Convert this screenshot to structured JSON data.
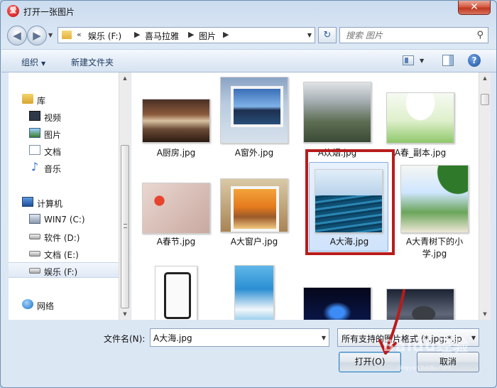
{
  "window": {
    "title": "打开一张图片",
    "close_label": "✕",
    "app_icon": "爱"
  },
  "nav_buttons": {
    "back": "◀",
    "forward": "▶"
  },
  "address": {
    "overflow": "«",
    "segments": [
      "娱乐 (F:)",
      "喜马拉雅",
      "图片"
    ]
  },
  "search": {
    "placeholder": "搜索 图片"
  },
  "toolbar": {
    "organize": "组织",
    "new_folder": "新建文件夹",
    "help": "?"
  },
  "sidebar": {
    "items": [
      {
        "label": "库",
        "icon": "library-icon"
      },
      {
        "label": "视频",
        "icon": "video-icon"
      },
      {
        "label": "图片",
        "icon": "pictures-icon"
      },
      {
        "label": "文档",
        "icon": "documents-icon"
      },
      {
        "label": "音乐",
        "icon": "music-icon"
      },
      {
        "label": "计算机",
        "icon": "computer-icon"
      },
      {
        "label": "WIN7 (C:)",
        "icon": "system-drive-icon"
      },
      {
        "label": "软件 (D:)",
        "icon": "drive-icon"
      },
      {
        "label": "文档 (E:)",
        "icon": "drive-icon"
      },
      {
        "label": "娱乐 (F:)",
        "icon": "drive-icon",
        "selected": true
      },
      {
        "label": "网络",
        "icon": "network-icon"
      }
    ]
  },
  "files": [
    {
      "name": "A厨房.jpg"
    },
    {
      "name": "A窗外.jpg"
    },
    {
      "name": "A炊烟.jpg"
    },
    {
      "name": "A春_副本.jpg"
    },
    {
      "name": "A春节.jpg"
    },
    {
      "name": "A大窗户.jpg"
    },
    {
      "name": "A大海.jpg",
      "selected": true
    },
    {
      "name": "A大青树下的小",
      "name_line2": "学.jpg"
    },
    {
      "name": ""
    },
    {
      "name": ""
    },
    {
      "name": ""
    },
    {
      "name": ""
    }
  ],
  "footer": {
    "filename_label": "文件名(N):",
    "filename_value": "A大海.jpg",
    "filter_value": "所有支持的图片格式 (*.jpg;*.jp",
    "open_label": "打开(O)",
    "cancel_label": "取消"
  },
  "watermark": {
    "text": "Baidu经验",
    "sub": "jingyan.baidu.com"
  },
  "colors": {
    "highlight": "#b81c1c",
    "accent": "#3c7fb1"
  }
}
